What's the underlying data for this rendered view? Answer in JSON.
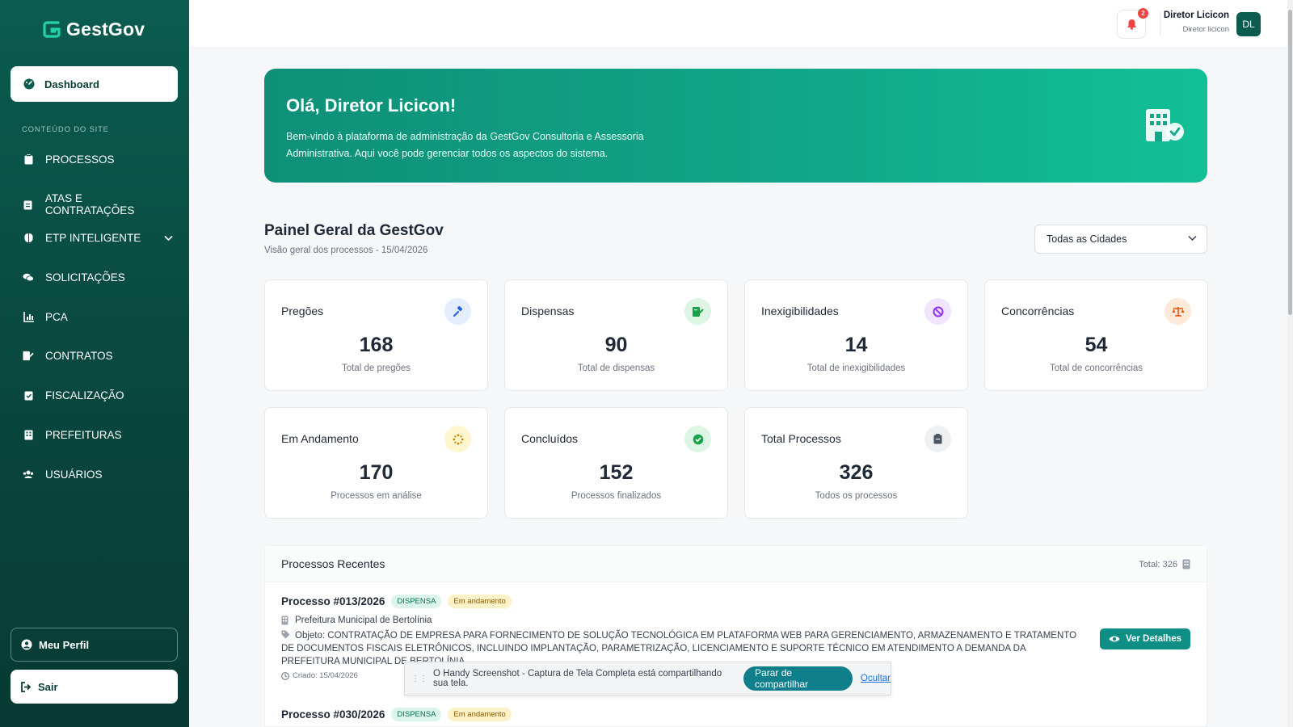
{
  "app": {
    "logo_text": "GestGov"
  },
  "sidebar": {
    "active_item": "Dashboard",
    "section_label": "CONTEÚDO DO SITE",
    "items": [
      {
        "label": "PROCESSOS",
        "icon": "clipboard-icon"
      },
      {
        "label": "ATAS E CONTRATAÇÕES",
        "icon": "clipboard-list-icon"
      },
      {
        "label": "ETP INTELIGENTE",
        "icon": "brain-icon"
      },
      {
        "label": "SOLICITAÇÕES",
        "icon": "chat-bubbles-icon"
      },
      {
        "label": "PCA",
        "icon": "bar-chart-icon"
      },
      {
        "label": "CONTRATOS",
        "icon": "file-signature-icon"
      },
      {
        "label": "FISCALIZAÇÃO",
        "icon": "clipboard-check-icon"
      },
      {
        "label": "PREFEITURAS",
        "icon": "building-icon"
      },
      {
        "label": "USUÁRIOS",
        "icon": "users-icon"
      }
    ],
    "profile_label": "Meu Perfil",
    "logout_label": "Sair"
  },
  "topbar": {
    "notification_count": "2",
    "user_name": "Diretor Licicon",
    "user_role": "Diretor licicon",
    "avatar_initials": "DL"
  },
  "hero": {
    "title": "Olá, Diretor Licicon!",
    "text": "Bem-vindo à plataforma de administração da GestGov Consultoria e Assessoria Administrativa. Aqui você pode gerenciar todos os aspectos do sistema."
  },
  "panel": {
    "title": "Painel Geral da GestGov",
    "subtitle": "Visão geral dos processos - 15/04/2026",
    "city_filter": "Todas as Cidades"
  },
  "stats": [
    {
      "title": "Pregões",
      "value": "168",
      "label": "Total de pregões",
      "icon": "gavel-icon",
      "color": "#2563eb",
      "bg": "#e3edfd"
    },
    {
      "title": "Dispensas",
      "value": "90",
      "label": "Total de dispensas",
      "icon": "file-edit-icon",
      "color": "#16a34a",
      "bg": "#dcf5e5"
    },
    {
      "title": "Inexigibilidades",
      "value": "14",
      "label": "Total de inexigibilidades",
      "icon": "ban-icon",
      "color": "#9333ea",
      "bg": "#f1e5fd"
    },
    {
      "title": "Concorrências",
      "value": "54",
      "label": "Total de concorrências",
      "icon": "scale-icon",
      "color": "#ea580c",
      "bg": "#ffe9d9"
    },
    {
      "title": "Em Andamento",
      "value": "170",
      "label": "Processos em análise",
      "icon": "spinner-icon",
      "color": "#ca8a04",
      "bg": "#fdf6cf"
    },
    {
      "title": "Concluídos",
      "value": "152",
      "label": "Processos finalizados",
      "icon": "check-circle-icon",
      "color": "#16a34a",
      "bg": "#dcf5e5"
    },
    {
      "title": "Total Processos",
      "value": "326",
      "label": "Todos os processos",
      "icon": "clipboard-icon",
      "color": "#4b5563",
      "bg": "#eef0f2"
    }
  ],
  "recent": {
    "title": "Processos Recentes",
    "total": "Total: 326",
    "items": [
      {
        "title": "Processo #013/2026",
        "type": "DISPENSA",
        "status": "Em andamento",
        "org": "Prefeitura Municipal de Bertolínia",
        "object": "Objeto: CONTRATAÇÃO DE EMPRESA PARA FORNECIMENTO DE SOLUÇÃO TECNOLÓGICA EM PLATAFORMA WEB PARA GERENCIAMENTO, ARMAZENAMENTO E TRATAMENTO DE DOCUMENTOS FISCAIS ELETRÔNICOS, INCLUINDO IMPLANTAÇÃO, PARAMETRIZAÇÃO, LICENCIAMENTO E SUPORTE TÉCNICO EM ATENDIMENTO A DEMANDA DA PREFEITURA MUNICIPAL DE BERTOLÍNIA",
        "created": "Criado: 15/04/2026",
        "action": "Ver Detalhes"
      },
      {
        "title": "Processo #030/2026",
        "type": "DISPENSA",
        "status": "Em andamento"
      }
    ]
  },
  "share_banner": {
    "message": "O Handy Screenshot - Captura de Tela Completa está compartilhando sua tela.",
    "stop_label": "Parar de compartilhar",
    "hide_label": "Ocultar"
  },
  "colors": {
    "sidebar": "#0b5c4f",
    "accent": "#10a88a",
    "button": "#0e8f86"
  }
}
